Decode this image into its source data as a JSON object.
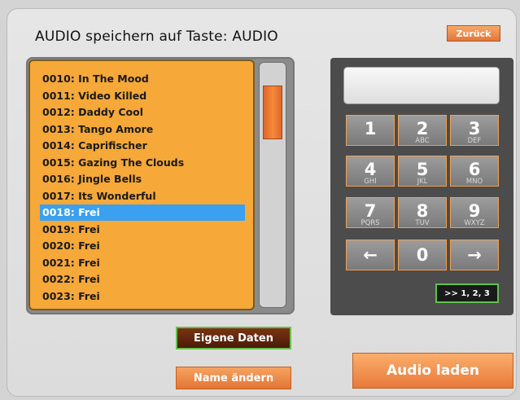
{
  "header": {
    "title": "AUDIO speichern auf Taste: AUDIO",
    "back_label": "Zurück"
  },
  "list": {
    "items": [
      "0010: In The Mood",
      "0011: Video Killed",
      "0012: Daddy Cool",
      "0013: Tango Amore",
      "0014: Caprifischer",
      "0015: Gazing The Clouds",
      "0016: Jingle Bells",
      "0017: Its Wonderful",
      "0018: Frei",
      "0019: Frei",
      "0020: Frei",
      "0021: Frei",
      "0022: Frei",
      "0023: Frei"
    ],
    "selected_index": 8
  },
  "keypad": {
    "display_value": "",
    "keys": [
      {
        "num": "1",
        "letters": ""
      },
      {
        "num": "2",
        "letters": "ABC"
      },
      {
        "num": "3",
        "letters": "DEF"
      },
      {
        "num": "4",
        "letters": "GHI"
      },
      {
        "num": "5",
        "letters": "JKL"
      },
      {
        "num": "6",
        "letters": "MNO"
      },
      {
        "num": "7",
        "letters": "PQRS"
      },
      {
        "num": "8",
        "letters": "TUV"
      },
      {
        "num": "9",
        "letters": "WXYZ"
      }
    ],
    "left_arrow": "←",
    "zero": "0",
    "right_arrow": "→",
    "mode_label": ">> 1, 2, 3"
  },
  "buttons": {
    "eigene_daten": "Eigene Daten",
    "name_aendern": "Name ändern",
    "audio_laden": "Audio laden"
  }
}
